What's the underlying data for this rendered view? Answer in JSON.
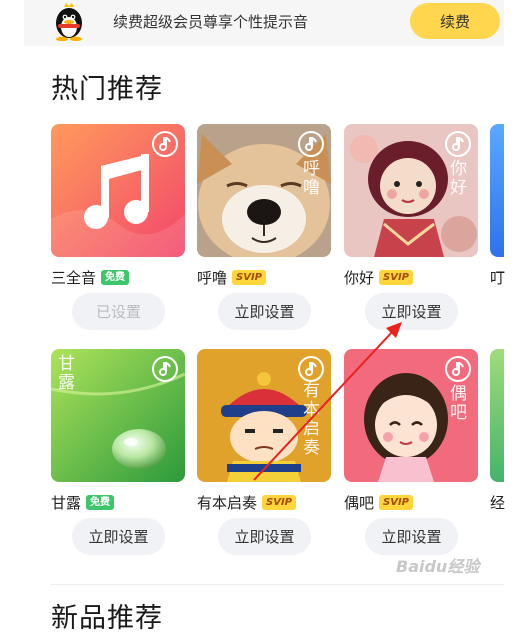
{
  "banner": {
    "text": "续费超级会员尊享个性提示音",
    "renew_label": "续费"
  },
  "section": {
    "title": "热门推荐"
  },
  "cards": [
    {
      "name": "三全音",
      "tag": "免费",
      "button": "已设置",
      "art_text": ""
    },
    {
      "name": "呼噜",
      "tag": "SVIP",
      "button": "立即设置",
      "art_text": "呼噜"
    },
    {
      "name": "你好",
      "tag": "SVIP",
      "button": "立即设置",
      "art_text": "你好"
    },
    {
      "name": "甘露",
      "tag": "免费",
      "button": "立即设置",
      "art_text": "甘露"
    },
    {
      "name": "有本启奏",
      "tag": "SVIP",
      "button": "立即设置",
      "art_text": "有本启奏"
    },
    {
      "name": "偶吧",
      "tag": "SVIP",
      "button": "立即设置",
      "art_text": "偶吧"
    }
  ],
  "edge": {
    "row1_name": "叮",
    "row2_name": "经"
  },
  "next_section": {
    "title": "新品推荐"
  },
  "watermark": "Baidu经验",
  "colors": {
    "accent_yellow": "#ffd64d",
    "free_green": "#3ec66a",
    "svip_yellow": "#ffd53c",
    "arrow_red": "#e8231f"
  }
}
